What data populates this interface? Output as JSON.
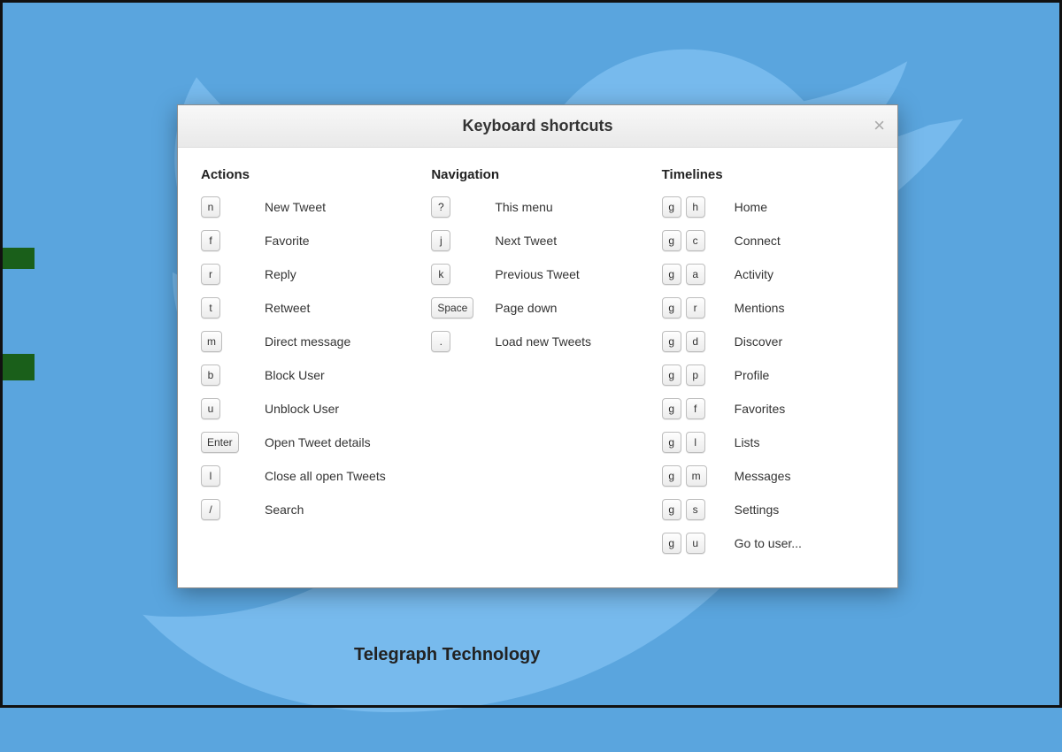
{
  "modal": {
    "title": "Keyboard shortcuts",
    "close_icon": "×"
  },
  "columns": {
    "actions": {
      "heading": "Actions",
      "rows": [
        {
          "keys": [
            "n"
          ],
          "label": "New Tweet"
        },
        {
          "keys": [
            "f"
          ],
          "label": "Favorite"
        },
        {
          "keys": [
            "r"
          ],
          "label": "Reply"
        },
        {
          "keys": [
            "t"
          ],
          "label": "Retweet"
        },
        {
          "keys": [
            "m"
          ],
          "label": "Direct message"
        },
        {
          "keys": [
            "b"
          ],
          "label": "Block User"
        },
        {
          "keys": [
            "u"
          ],
          "label": "Unblock User"
        },
        {
          "keys": [
            "Enter"
          ],
          "label": "Open Tweet details"
        },
        {
          "keys": [
            "l"
          ],
          "label": "Close all open Tweets"
        },
        {
          "keys": [
            "/"
          ],
          "label": "Search"
        }
      ]
    },
    "navigation": {
      "heading": "Navigation",
      "rows": [
        {
          "keys": [
            "?"
          ],
          "label": "This menu"
        },
        {
          "keys": [
            "j"
          ],
          "label": "Next Tweet"
        },
        {
          "keys": [
            "k"
          ],
          "label": "Previous Tweet"
        },
        {
          "keys": [
            "Space"
          ],
          "label": "Page down"
        },
        {
          "keys": [
            "."
          ],
          "label": "Load new Tweets"
        }
      ]
    },
    "timelines": {
      "heading": "Timelines",
      "rows": [
        {
          "keys": [
            "g",
            "h"
          ],
          "label": "Home"
        },
        {
          "keys": [
            "g",
            "c"
          ],
          "label": "Connect"
        },
        {
          "keys": [
            "g",
            "a"
          ],
          "label": "Activity"
        },
        {
          "keys": [
            "g",
            "r"
          ],
          "label": "Mentions"
        },
        {
          "keys": [
            "g",
            "d"
          ],
          "label": "Discover"
        },
        {
          "keys": [
            "g",
            "p"
          ],
          "label": "Profile"
        },
        {
          "keys": [
            "g",
            "f"
          ],
          "label": "Favorites"
        },
        {
          "keys": [
            "g",
            "l"
          ],
          "label": "Lists"
        },
        {
          "keys": [
            "g",
            "m"
          ],
          "label": "Messages"
        },
        {
          "keys": [
            "g",
            "s"
          ],
          "label": "Settings"
        },
        {
          "keys": [
            "g",
            "u"
          ],
          "label": "Go to user..."
        }
      ]
    }
  },
  "background": {
    "peek_text": "Telegraph Technology"
  }
}
